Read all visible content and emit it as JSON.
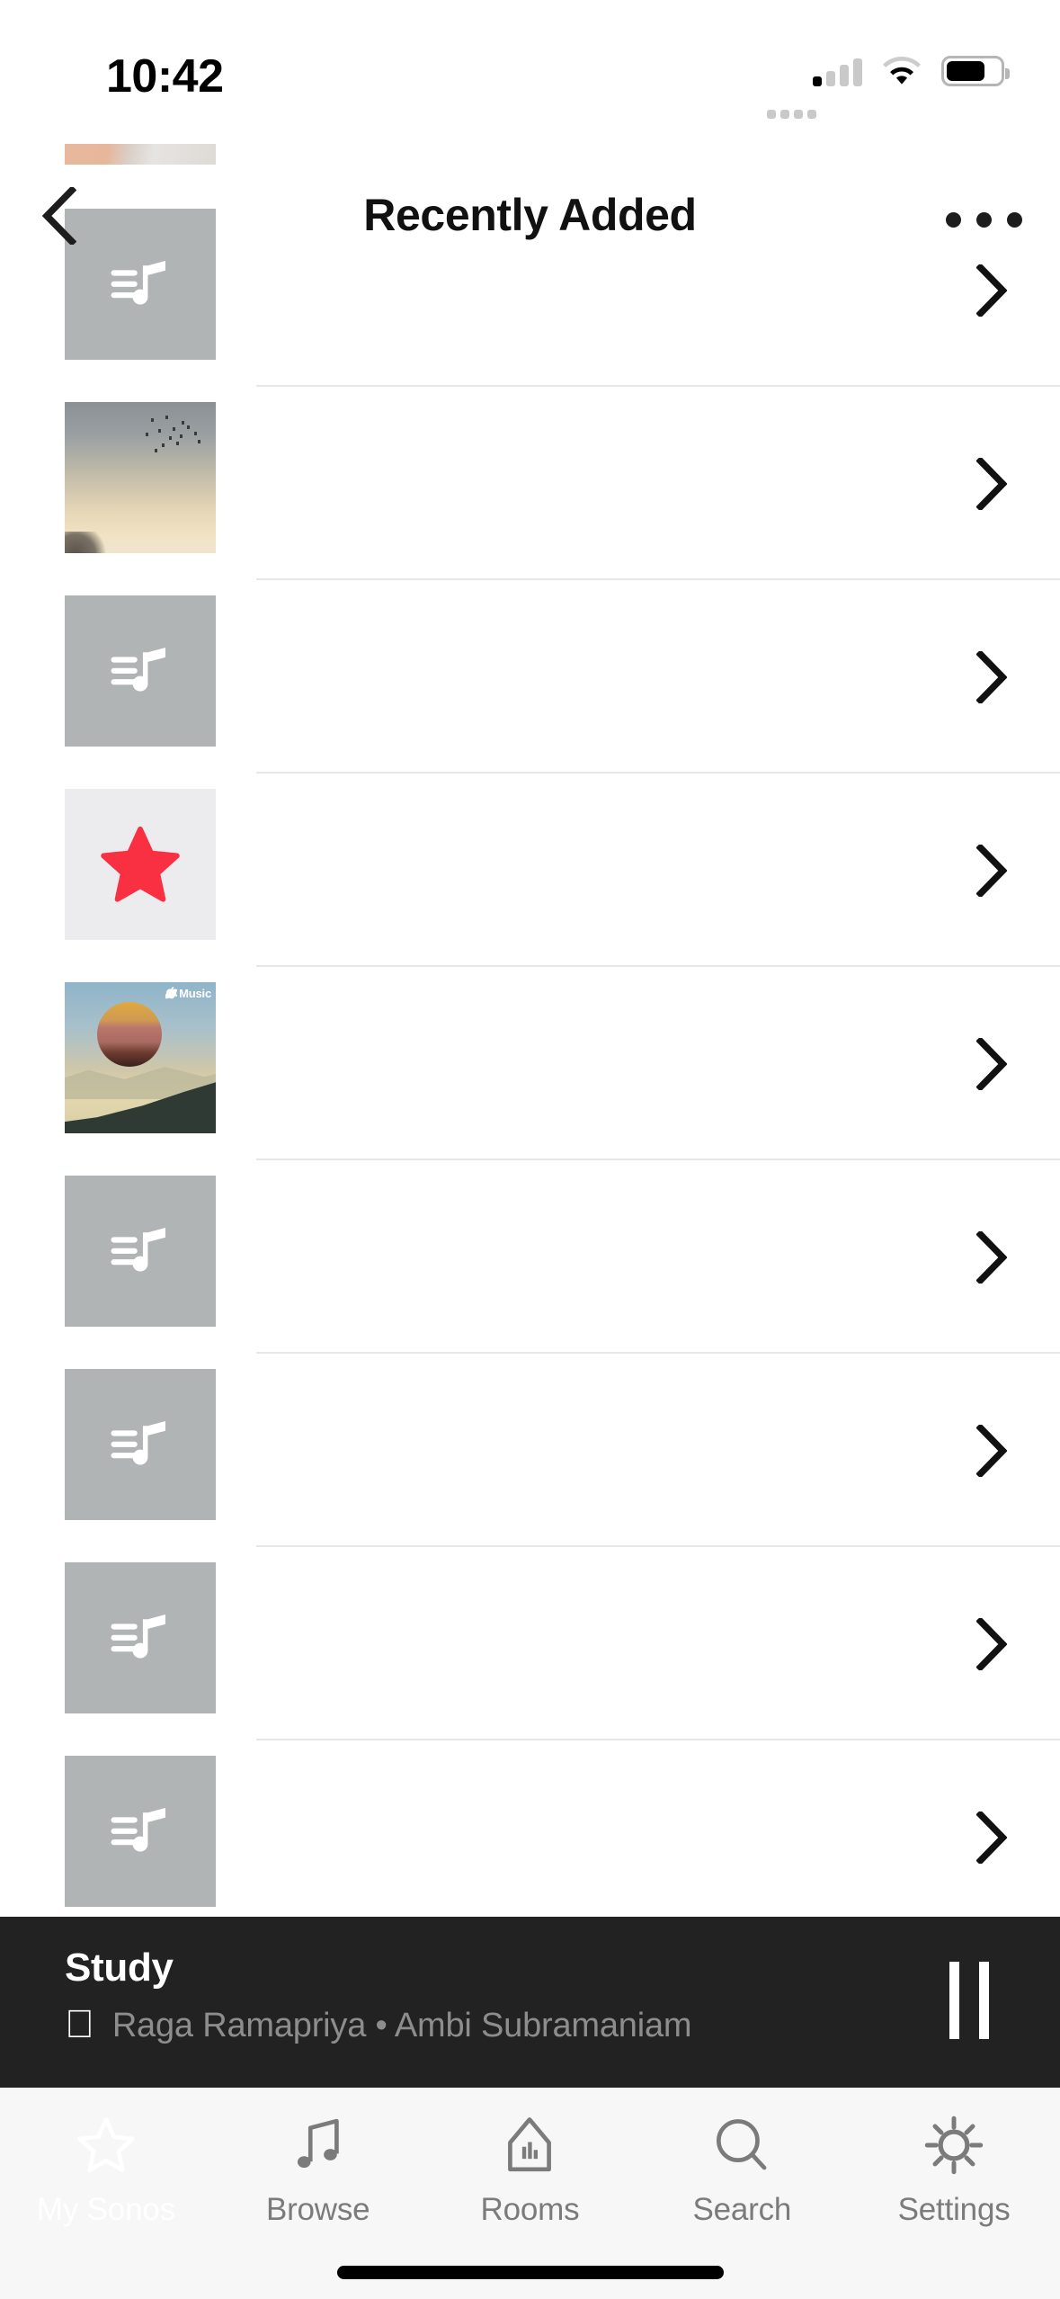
{
  "app": {
    "name": "Sonos",
    "background": "#ffffff"
  },
  "status_bar": {
    "time": "10:42",
    "cellular_icon": "cellular-signal-icon",
    "wifi_icon": "wifi-icon",
    "battery_icon": "battery-icon",
    "battery_level_percent": 72
  },
  "nav": {
    "back_icon": "chevron-left-icon",
    "title": "Recently Added",
    "more_icon": "ellipsis-icon"
  },
  "list": {
    "disclosure_icon": "chevron-right-icon",
    "rows": [
      {
        "artwork": "photo-hand",
        "label": "",
        "partial": true
      },
      {
        "artwork": "music-note-placeholder",
        "label": ""
      },
      {
        "artwork": "photo-sunset",
        "label": ""
      },
      {
        "artwork": "music-note-placeholder",
        "label": ""
      },
      {
        "artwork": "star-favorite",
        "label": ""
      },
      {
        "artwork": "apple-music-cover",
        "label": ""
      },
      {
        "artwork": "music-note-placeholder",
        "label": ""
      },
      {
        "artwork": "music-note-placeholder",
        "label": ""
      },
      {
        "artwork": "music-note-placeholder",
        "label": ""
      },
      {
        "artwork": "music-note-placeholder",
        "label": ""
      }
    ]
  },
  "now_playing": {
    "room": "Study",
    "source_icon": "apple-logo-icon",
    "track": "Raga Ramapriya",
    "separator": "•",
    "artist": "Ambi Subramaniam",
    "subtitle": "Raga Ramapriya • Ambi Subramaniam",
    "transport_icon": "pause-icon",
    "background": "#222222"
  },
  "tab_bar": {
    "background": "#f7f7f7",
    "active_index": 0,
    "tabs": [
      {
        "label": "My Sonos",
        "icon": "star-icon"
      },
      {
        "label": "Browse",
        "icon": "music-note-icon"
      },
      {
        "label": "Rooms",
        "icon": "house-bars-icon"
      },
      {
        "label": "Search",
        "icon": "magnifier-icon"
      },
      {
        "label": "Settings",
        "icon": "gear-icon"
      }
    ]
  },
  "home_indicator": {
    "icon": "home-indicator"
  },
  "colors": {
    "star_red": "#f92f42",
    "placeholder_gray": "#b0b4b5",
    "divider": "#e7e7e7",
    "tab_inactive": "#7b7b7b",
    "tab_active": "#ffffff",
    "now_playing_bg": "#222222"
  }
}
